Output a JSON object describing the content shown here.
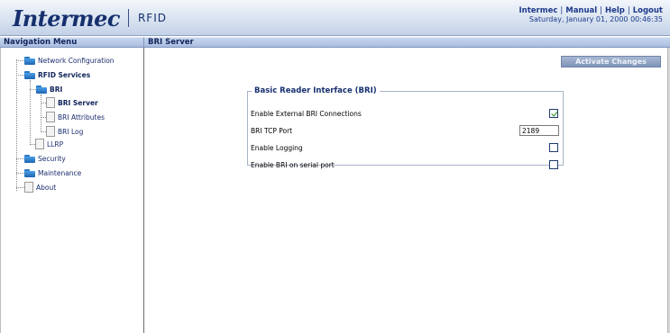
{
  "header": {
    "brand": "Intermec",
    "product": "RFID",
    "links": [
      "Intermec",
      "Manual",
      "Help",
      "Logout"
    ],
    "separator": "|",
    "datetime": "Saturday, January 01, 2000 00:46:35"
  },
  "nav": {
    "title": "Navigation Menu",
    "items": [
      {
        "label": "Network Configuration"
      },
      {
        "label": "RFID Services"
      },
      {
        "label": "BRI"
      },
      {
        "label": "BRI Server"
      },
      {
        "label": "BRI Attributes"
      },
      {
        "label": "BRI Log"
      },
      {
        "label": "LLRP"
      },
      {
        "label": "Security"
      },
      {
        "label": "Maintenance"
      },
      {
        "label": "About"
      }
    ]
  },
  "main": {
    "title": "BRI Server",
    "activate_label": "Activate Changes",
    "fieldset_legend": "Basic Reader Interface (BRI)",
    "rows": [
      {
        "label": "Enable External BRI Connections",
        "checked": true
      },
      {
        "label": "BRI TCP Port",
        "value": "2189"
      },
      {
        "label": "Enable Logging",
        "checked": false
      },
      {
        "label": "Enable BRI on serial port",
        "checked": false
      }
    ]
  },
  "colors": {
    "brand_blue": "#16306e",
    "title_bar": "#a9bde0",
    "check_green": "#1f8a1f"
  }
}
